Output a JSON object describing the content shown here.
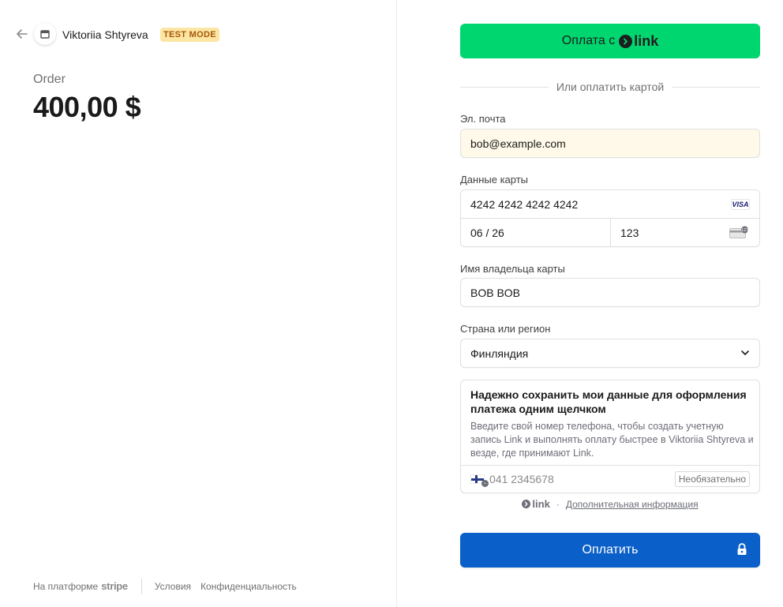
{
  "header": {
    "merchant_name": "Viktoriia Shtyreva",
    "test_badge": "TEST MODE"
  },
  "order": {
    "label": "Order",
    "amount": "400,00 $"
  },
  "footer": {
    "powered_by": "На платформе",
    "brand": "stripe",
    "terms": "Условия",
    "privacy": "Конфиденциальность"
  },
  "link_button": {
    "label": "Оплата с",
    "brand": "link"
  },
  "divider_text": "Или оплатить картой",
  "email": {
    "label": "Эл. почта",
    "value": "bob@example.com"
  },
  "card": {
    "label": "Данные карты",
    "number": "4242 4242 4242 4242",
    "brand": "VISA",
    "expiry": "06 / 26",
    "cvc": "123"
  },
  "cardholder": {
    "label": "Имя владельца карты",
    "value": "BOB BOB"
  },
  "country": {
    "label": "Страна или регион",
    "value": "Финляндия"
  },
  "save_info": {
    "title": "Надежно сохранить мои данные для оформления платежа одним щелчком",
    "description": "Введите свой номер телефона, чтобы создать учетную запись Link и выполнять оплату быстрее в Viktoriia Shtyreva и везде, где принимают Link.",
    "phone_placeholder": "041 2345678",
    "optional": "Необязательно"
  },
  "link_info": {
    "brand": "link",
    "separator": "·",
    "more_info": "Дополнительная информация"
  },
  "pay_button": {
    "label": "Оплатить"
  },
  "colors": {
    "link_green": "#00d66f",
    "pay_blue": "#0a5fc9",
    "test_badge_bg": "#fde6a3",
    "test_badge_text": "#a5580a"
  }
}
